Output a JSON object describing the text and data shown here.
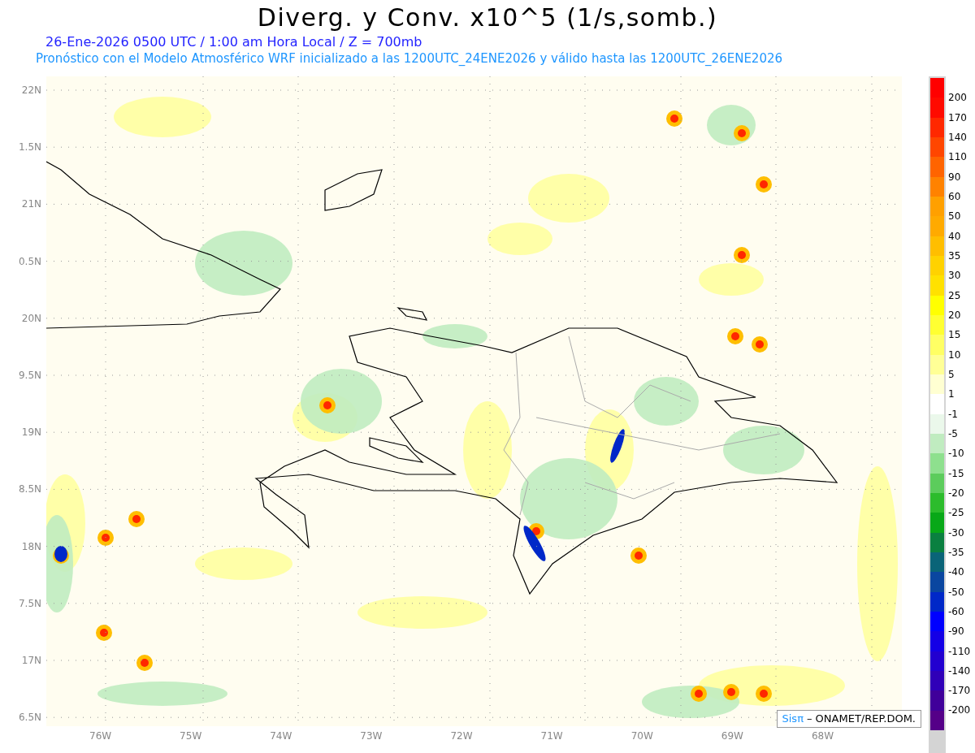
{
  "title": "Diverg. y Conv. x10^5 (1/s,somb.)",
  "subtitle": "26-Ene-2026  0500 UTC / 1:00 am Hora Local / Z = 700mb",
  "forecast_line": "Pronóstico con el Modelo Atmosférico WRF inicializado a las 1200UTC_24ENE2026 y válido hasta las  1200UTC_26ENE2026",
  "y_axis": {
    "labels": [
      "22N",
      "1.5N",
      "21N",
      "0.5N",
      "20N",
      "9.5N",
      "19N",
      "8.5N",
      "18N",
      "7.5N",
      "17N",
      "6.5N"
    ]
  },
  "x_axis": {
    "labels": [
      "76W",
      "75W",
      "74W",
      "73W",
      "72W",
      "71W",
      "70W",
      "69W",
      "68W"
    ]
  },
  "credit": {
    "logo": "Sisπ",
    "text": "– ONAMET/REP.DOM."
  },
  "colorbar": {
    "boxes": [
      {
        "color": "#ff0000"
      },
      {
        "color": "#ff0a00"
      },
      {
        "color": "#ff2800"
      },
      {
        "color": "#ff4600"
      },
      {
        "color": "#ff6400"
      },
      {
        "color": "#ff8200"
      },
      {
        "color": "#ffa000"
      },
      {
        "color": "#ffaa00"
      },
      {
        "color": "#ffbe00"
      },
      {
        "color": "#ffd200"
      },
      {
        "color": "#ffe100"
      },
      {
        "color": "#ffff00"
      },
      {
        "color": "#ffff32"
      },
      {
        "color": "#ffff64"
      },
      {
        "color": "#ffff96"
      },
      {
        "color": "#ffffd2"
      },
      {
        "color": "#ffffff"
      },
      {
        "color": "#ebf8eb"
      },
      {
        "color": "#c0ecc0"
      },
      {
        "color": "#8ee08e"
      },
      {
        "color": "#5ccc5c"
      },
      {
        "color": "#2cbc2c"
      },
      {
        "color": "#08a818"
      },
      {
        "color": "#0a8040"
      },
      {
        "color": "#0a6478"
      },
      {
        "color": "#0a46a0"
      },
      {
        "color": "#0028c8"
      },
      {
        "color": "#0000ff"
      },
      {
        "color": "#1400e6"
      },
      {
        "color": "#2200d0"
      },
      {
        "color": "#3000b8"
      },
      {
        "color": "#40009a"
      },
      {
        "color": "#550088"
      }
    ],
    "labels": [
      "200",
      "170",
      "140",
      "110",
      "90",
      "60",
      "50",
      "40",
      "35",
      "30",
      "25",
      "20",
      "15",
      "10",
      "5",
      "1",
      "-1",
      "-5",
      "-10",
      "-15",
      "-20",
      "-25",
      "-30",
      "-35",
      "-40",
      "-50",
      "-60",
      "-90",
      "-110",
      "-140",
      "-170",
      "-200"
    ]
  }
}
